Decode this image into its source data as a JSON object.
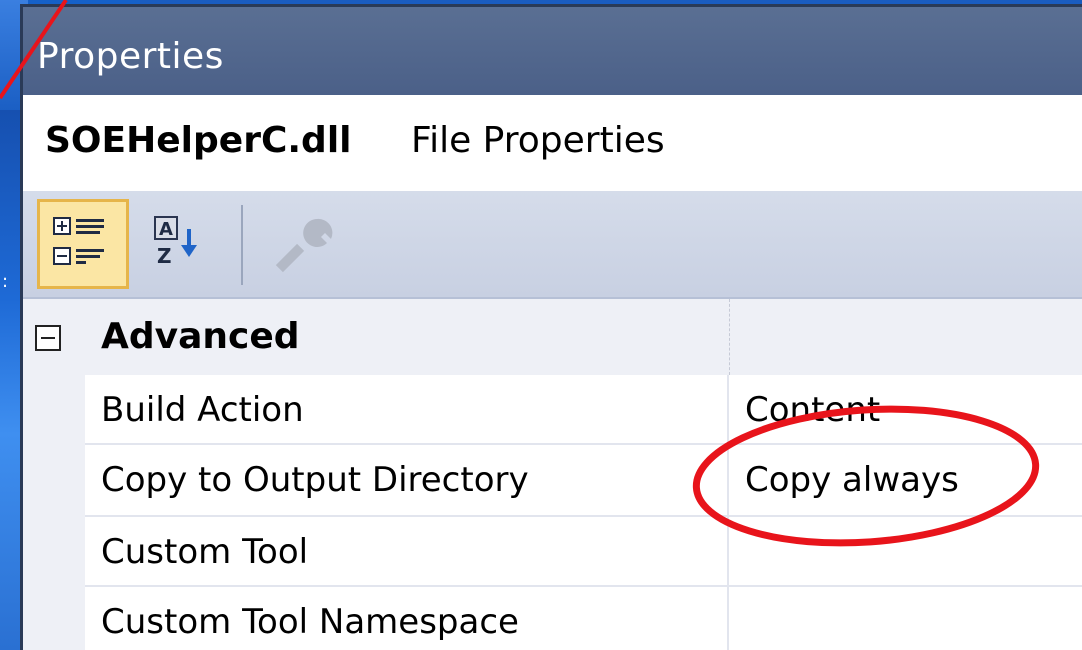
{
  "window": {
    "title": "Properties"
  },
  "header": {
    "file_name": "SOEHelperC.dll",
    "file_suffix": "File Properties"
  },
  "toolbar": {
    "buttons": [
      {
        "name": "categorized-button",
        "icon": "categorized-icon",
        "active": true
      },
      {
        "name": "alphabetical-button",
        "icon": "alphabetical-sort-icon",
        "active": false
      },
      {
        "name": "property-pages-button",
        "icon": "wrench-icon",
        "active": false,
        "disabled": true
      }
    ]
  },
  "grid": {
    "category": {
      "label": "Advanced",
      "expanded": true
    },
    "properties": [
      {
        "name": "Build Action",
        "value": "Content"
      },
      {
        "name": "Copy to Output Directory",
        "value": "Copy always"
      },
      {
        "name": "Custom Tool",
        "value": ""
      },
      {
        "name": "Custom Tool Namespace",
        "value": ""
      }
    ]
  },
  "colors": {
    "title_bar": "#4b6088",
    "toolbar": "#cdd4e6",
    "active_button": "#fbe6a4",
    "annotation": "#e8141b"
  }
}
